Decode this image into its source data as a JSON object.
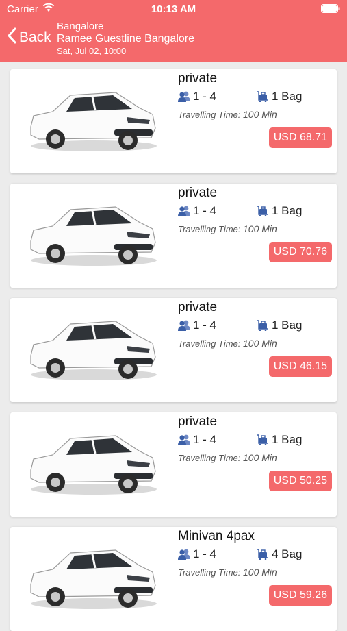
{
  "status_bar": {
    "carrier": "Carrier",
    "time": "10:13 AM"
  },
  "header": {
    "back_label": "Back",
    "city": "Bangalore",
    "hotel": "Ramee Guestline Bangalore",
    "date": "Sat, Jul 02, 10:00"
  },
  "colors": {
    "accent": "#f4696b",
    "icon_blue": "#3b5fa7"
  },
  "travelling_time_label": "Travelling Time:",
  "transfers": [
    {
      "type": "private",
      "pax": "1 - 4",
      "bags": "1 Bag",
      "time": "100 Min",
      "price": "USD 68.71"
    },
    {
      "type": "private",
      "pax": "1 - 4",
      "bags": "1 Bag",
      "time": "100 Min",
      "price": "USD 70.76"
    },
    {
      "type": "private",
      "pax": "1 - 4",
      "bags": "1 Bag",
      "time": "100 Min",
      "price": "USD 46.15"
    },
    {
      "type": "private",
      "pax": "1 - 4",
      "bags": "1 Bag",
      "time": "100 Min",
      "price": "USD 50.25"
    },
    {
      "type": "Minivan 4pax",
      "pax": "1 - 4",
      "bags": "4 Bag",
      "time": "100 Min",
      "price": "USD 59.26"
    }
  ]
}
